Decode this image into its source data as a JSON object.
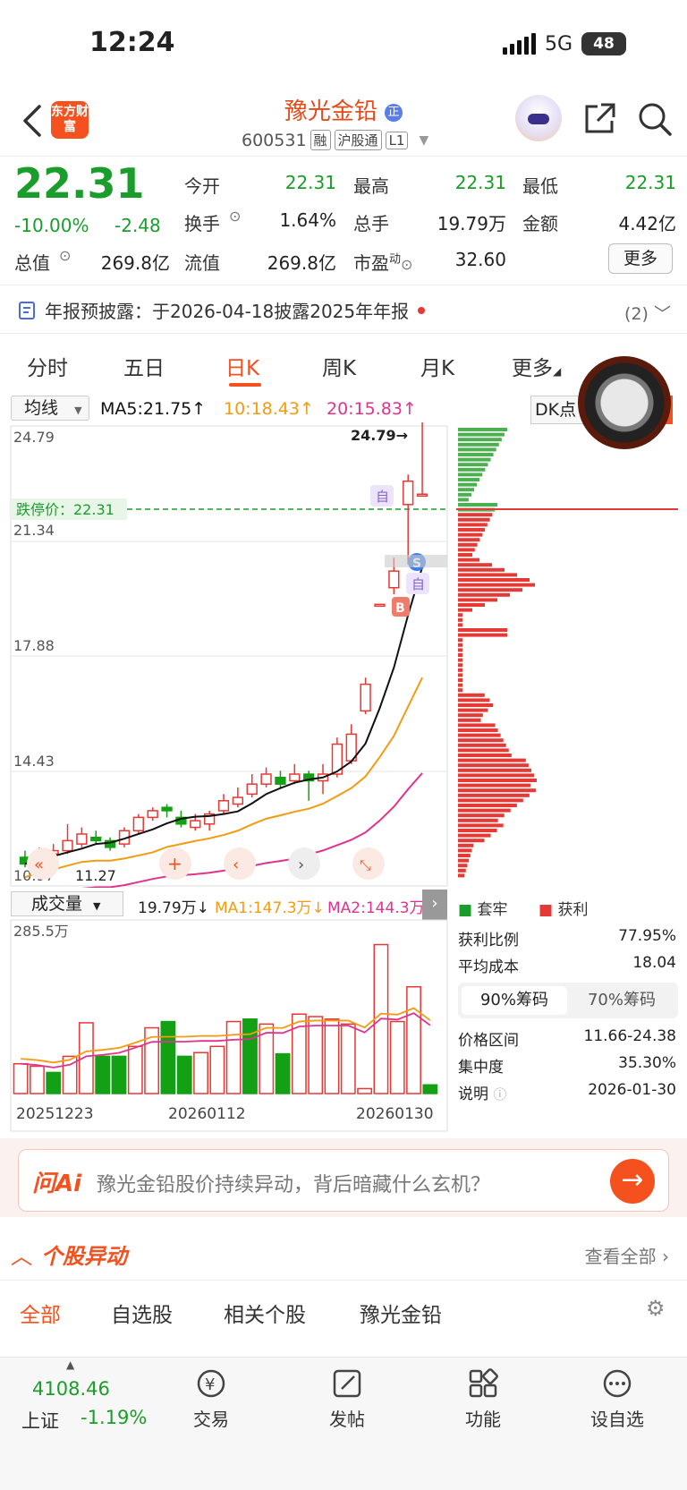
{
  "status": {
    "time": "12:24",
    "network": "5G",
    "battery": "48"
  },
  "header": {
    "logo": "东方财富",
    "stock_name": "豫光金铅",
    "stock_code": "600531",
    "tags": [
      "融",
      "沪股通",
      "L1"
    ]
  },
  "quote": {
    "price": "22.31",
    "pct": "-10.00%",
    "change": "-2.48",
    "rows": [
      [
        {
          "label": "今开",
          "value": "22.31"
        },
        {
          "label": "最高",
          "value": "22.31"
        },
        {
          "label": "最低",
          "value": "22.31"
        }
      ],
      [
        {
          "label": "换手",
          "value": "1.64%"
        },
        {
          "label": "总手",
          "value": "19.79万"
        },
        {
          "label": "金额",
          "value": "4.42亿"
        }
      ],
      [
        {
          "label": "总值",
          "value": "269.8亿"
        },
        {
          "label": "流值",
          "value": "269.8亿"
        },
        {
          "label": "市盈",
          "sup": "动",
          "value": "32.60"
        }
      ]
    ],
    "more": "更多"
  },
  "notice": {
    "text": "年报预披露：于2026-04-18披露2025年年报",
    "count": "(2)"
  },
  "tabs": [
    "分时",
    "五日",
    "日K",
    "周K",
    "月K",
    "更多"
  ],
  "active_tab": "日K",
  "kline": {
    "ma_select": "均线",
    "ma5": "MA5:21.75↑",
    "ma10": "10:18.43↑",
    "ma20": "20:15.83↑",
    "dk": "DK点",
    "y_ticks": [
      "24.79",
      "21.34",
      "17.88",
      "14.43",
      "10.97"
    ],
    "limit_label": "跌停价：22.31",
    "high_label": "24.79→",
    "low_label": "11.27",
    "markers": [
      "自",
      "S",
      "自",
      "B"
    ],
    "colors": {
      "up": "#e53935",
      "down": "#14a014",
      "ma5": "#111111",
      "ma10": "#f39c12",
      "ma20": "#e0338e"
    }
  },
  "chart_data": {
    "type": "candlestick",
    "ma": {
      "MA5": 21.75,
      "MA10": 18.43,
      "MA20": 15.83
    },
    "ylim": [
      10.97,
      24.79
    ],
    "candles": [
      {
        "o": 11.4,
        "c": 11.2,
        "h": 11.6,
        "l": 11.1
      },
      {
        "o": 11.3,
        "c": 11.5,
        "h": 11.7,
        "l": 11.2
      },
      {
        "o": 11.5,
        "c": 11.6,
        "h": 11.8,
        "l": 11.3
      },
      {
        "o": 11.6,
        "c": 11.9,
        "h": 12.4,
        "l": 11.5
      },
      {
        "o": 11.8,
        "c": 12.1,
        "h": 12.3,
        "l": 11.7
      },
      {
        "o": 12.0,
        "c": 11.9,
        "h": 12.2,
        "l": 11.8
      },
      {
        "o": 11.9,
        "c": 11.7,
        "h": 12.0,
        "l": 11.6
      },
      {
        "o": 11.8,
        "c": 12.2,
        "h": 12.3,
        "l": 11.7
      },
      {
        "o": 12.2,
        "c": 12.6,
        "h": 12.7,
        "l": 12.1
      },
      {
        "o": 12.6,
        "c": 12.8,
        "h": 12.9,
        "l": 12.5
      },
      {
        "o": 12.9,
        "c": 12.8,
        "h": 13.0,
        "l": 12.6
      },
      {
        "o": 12.6,
        "c": 12.4,
        "h": 12.8,
        "l": 12.3
      },
      {
        "o": 12.3,
        "c": 12.5,
        "h": 12.7,
        "l": 12.2
      },
      {
        "o": 12.4,
        "c": 12.7,
        "h": 12.8,
        "l": 12.2
      },
      {
        "o": 12.8,
        "c": 13.1,
        "h": 13.3,
        "l": 12.7
      },
      {
        "o": 13.0,
        "c": 13.2,
        "h": 13.5,
        "l": 12.9
      },
      {
        "o": 13.3,
        "c": 13.6,
        "h": 13.9,
        "l": 13.2
      },
      {
        "o": 13.6,
        "c": 13.9,
        "h": 14.1,
        "l": 13.5
      },
      {
        "o": 13.8,
        "c": 13.6,
        "h": 14.0,
        "l": 13.5
      },
      {
        "o": 13.7,
        "c": 13.9,
        "h": 14.2,
        "l": 13.6
      },
      {
        "o": 13.9,
        "c": 13.7,
        "h": 14.0,
        "l": 13.1
      },
      {
        "o": 13.7,
        "c": 13.9,
        "h": 14.2,
        "l": 13.3
      },
      {
        "o": 13.9,
        "c": 14.8,
        "h": 15.0,
        "l": 13.8
      },
      {
        "o": 14.3,
        "c": 15.1,
        "h": 15.4,
        "l": 14.2
      },
      {
        "o": 15.8,
        "c": 16.6,
        "h": 16.8,
        "l": 15.7
      },
      {
        "o": 19.0,
        "c": 19.0,
        "h": 19.0,
        "l": 19.0
      },
      {
        "o": 19.5,
        "c": 20.0,
        "h": 20.4,
        "l": 19.3
      },
      {
        "o": 22.0,
        "c": 22.7,
        "h": 22.9,
        "l": 20.2
      },
      {
        "o": 22.31,
        "c": 22.31,
        "h": 24.79,
        "l": 22.31
      }
    ],
    "volume": {
      "y_max_label": "285.5万",
      "bars": [
        {
          "v": 1.2,
          "up": true
        },
        {
          "v": 1.1,
          "up": true
        },
        {
          "v": 0.85,
          "up": false
        },
        {
          "v": 1.5,
          "up": true
        },
        {
          "v": 2.85,
          "up": true
        },
        {
          "v": 1.5,
          "up": false
        },
        {
          "v": 1.5,
          "up": false
        },
        {
          "v": 1.9,
          "up": true
        },
        {
          "v": 2.65,
          "up": true
        },
        {
          "v": 2.9,
          "up": false
        },
        {
          "v": 1.5,
          "up": false
        },
        {
          "v": 1.65,
          "up": true
        },
        {
          "v": 1.9,
          "up": true
        },
        {
          "v": 2.9,
          "up": true
        },
        {
          "v": 3.0,
          "up": false
        },
        {
          "v": 2.8,
          "up": true
        },
        {
          "v": 1.6,
          "up": false
        },
        {
          "v": 3.2,
          "up": true
        },
        {
          "v": 3.1,
          "up": true
        },
        {
          "v": 3.0,
          "up": true
        },
        {
          "v": 2.8,
          "up": true
        },
        {
          "v": 0.2,
          "up": true
        },
        {
          "v": 6.0,
          "up": true
        },
        {
          "v": 2.9,
          "up": true
        },
        {
          "v": 4.3,
          "up": true
        },
        {
          "v": 0.35,
          "up": false
        }
      ],
      "x_labels": [
        "20251223",
        "20260112",
        "20260130"
      ]
    }
  },
  "volume_header": {
    "select": "成交量",
    "vol": "19.79万↓",
    "ma1": "MA1:147.3万↓",
    "ma2": "MA2:144.3万↓"
  },
  "chips": {
    "legend_trapped": "套牢",
    "legend_profit": "获利",
    "rows": [
      {
        "label": "获利比例",
        "value": "77.95%"
      },
      {
        "label": "平均成本",
        "value": "18.04"
      }
    ],
    "tabs": [
      "90%筹码",
      "70%筹码"
    ],
    "rows2": [
      {
        "label": "价格区间",
        "value": "11.66-24.38"
      },
      {
        "label": "集中度",
        "value": "35.30%"
      },
      {
        "label": "说明",
        "value": "2026-01-30"
      }
    ]
  },
  "ai": {
    "logo": "问Ai",
    "prompt": "豫光金铅股价持续异动，背后暗藏什么玄机？"
  },
  "moves": {
    "title": "个股异动",
    "view_all": "查看全部",
    "tabs": [
      "全部",
      "自选股",
      "相关个股",
      "豫光金铅"
    ]
  },
  "bottom": {
    "index_value": "4108.46",
    "index_name": "上证",
    "index_pct": "-1.19%",
    "items": [
      "交易",
      "发帖",
      "功能",
      "设自选"
    ]
  }
}
